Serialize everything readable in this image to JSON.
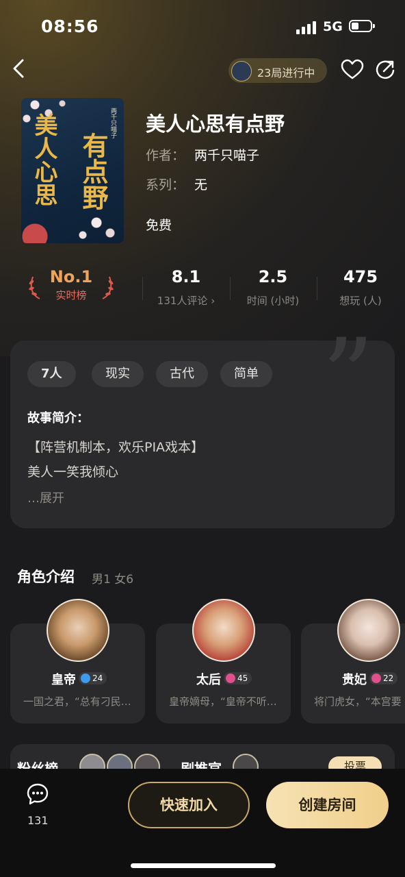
{
  "status_bar": {
    "time": "08:56",
    "network": "5G"
  },
  "nav": {
    "rounds_text": "23局进行中"
  },
  "book": {
    "title": "美人心思有点野",
    "author_label": "作者：",
    "author": "两千只喵子",
    "series_label": "系列：",
    "series": "无",
    "price": "免费",
    "cover_title_a": "美人心思",
    "cover_title_b": "有点野",
    "cover_author": "两千只喵子"
  },
  "stats": {
    "rank_no": "No.1",
    "rank_label": "实时榜",
    "rating": "8.1",
    "rating_label": "131人评论 ›",
    "duration": "2.5",
    "duration_label": "时间 (小时)",
    "want": "475",
    "want_label": "想玩 (人)"
  },
  "tags": [
    "7人",
    "现实",
    "古代",
    "简单"
  ],
  "story": {
    "heading": "故事简介：",
    "lines": [
      "【阵营机制本，欢乐PIA戏本】",
      "美人一笑我倾心"
    ],
    "expand": "…展开"
  },
  "roles": {
    "heading": "角色介绍",
    "summary": "男1 女6",
    "items": [
      {
        "name": "皇帝",
        "count": "24",
        "badge_color": "#3f9bea",
        "desc": "一国之君，“总有刁民…"
      },
      {
        "name": "太后",
        "count": "45",
        "badge_color": "#e0508c",
        "desc": "皇帝嫡母，“皇帝不听…"
      },
      {
        "name": "贵妃",
        "count": "22",
        "badge_color": "#e0508c",
        "desc": "将门虎女，“本宫要"
      }
    ]
  },
  "fan_section": {
    "title": "粉丝榜",
    "title2": "剧推官",
    "vote": "投票"
  },
  "bottom": {
    "chat_count": "131",
    "quick_join": "快速加入",
    "create_room": "创建房间"
  }
}
